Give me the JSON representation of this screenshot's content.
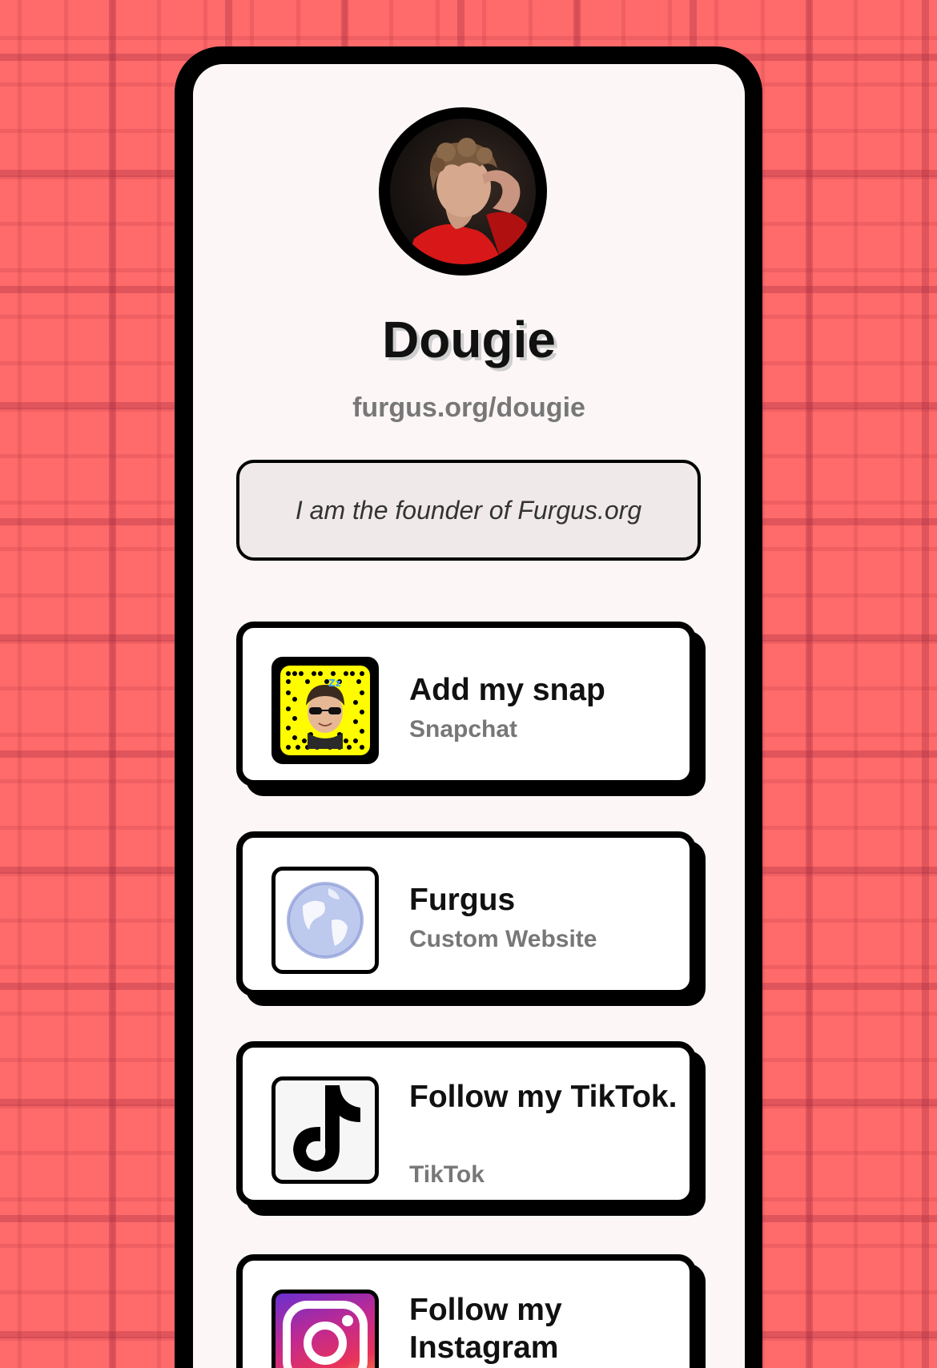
{
  "profile": {
    "name": "Dougie",
    "handle": "furgus.org/dougie",
    "bio": "I am the founder of Furgus.org"
  },
  "links": [
    {
      "title": "Add my snap",
      "subtitle": "Snapchat",
      "icon": "snapcode-icon"
    },
    {
      "title": "Furgus",
      "subtitle": "Custom Website",
      "icon": "globe-icon"
    },
    {
      "title": "Follow my TikTok.",
      "subtitle": "TikTok",
      "icon": "tiktok-icon"
    },
    {
      "title": "Follow my Instagram",
      "subtitle": "",
      "icon": "instagram-icon"
    }
  ],
  "colors": {
    "background": "#ff6a6a",
    "card": "#ffffff",
    "border": "#000000",
    "muted_text": "#777777",
    "snap_yellow": "#fffc00"
  }
}
